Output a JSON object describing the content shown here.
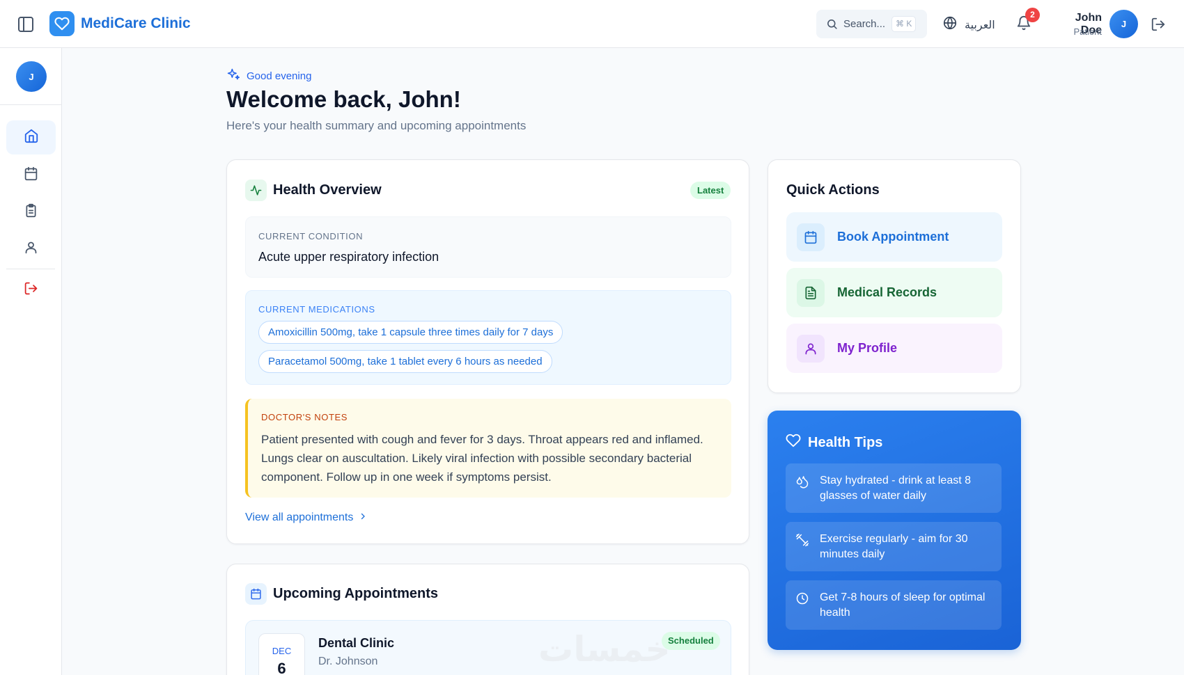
{
  "header": {
    "brand": "MediCare Clinic",
    "search_placeholder": "Search...",
    "search_shortcut": "⌘ K",
    "language": "العربية",
    "notifications_count": "2",
    "user_name": "John Doe",
    "user_role": "Patient",
    "avatar_initial": "J"
  },
  "sidebar": {
    "avatar_initial": "J",
    "items": [
      {
        "name": "home",
        "active": true
      },
      {
        "name": "appointments",
        "active": false
      },
      {
        "name": "records",
        "active": false
      },
      {
        "name": "profile",
        "active": false
      },
      {
        "name": "logout",
        "active": false
      }
    ]
  },
  "hero": {
    "greeting": "Good evening",
    "title": "Welcome back, John!",
    "subtitle": "Here's your health summary and upcoming appointments"
  },
  "overview": {
    "title": "Health Overview",
    "badge": "Latest",
    "condition_label": "CURRENT CONDITION",
    "condition": "Acute upper respiratory infection",
    "medications_label": "CURRENT MEDICATIONS",
    "medications": [
      "Amoxicillin 500mg, take 1 capsule three times daily for 7 days",
      "Paracetamol 500mg, take 1 tablet every 6 hours as needed"
    ],
    "notes_label": "DOCTOR'S NOTES",
    "notes": "Patient presented with cough and fever for 3 days. Throat appears red and inflamed. Lungs clear on auscultation. Likely viral infection with possible secondary bacterial component. Follow up in one week if symptoms persist.",
    "view_all": "View all appointments"
  },
  "upcoming": {
    "title": "Upcoming Appointments",
    "appointments": [
      {
        "month": "DEC",
        "day": "6",
        "clinic": "Dental Clinic",
        "doctor": "Dr. Johnson",
        "status": "Scheduled"
      }
    ],
    "watermark": "خمسات"
  },
  "quick_actions": {
    "title": "Quick Actions",
    "items": [
      {
        "label": "Book Appointment",
        "color": "#1d6fd8",
        "bg": "#eef7fe",
        "icon": "calendar-icon"
      },
      {
        "label": "Medical Records",
        "color": "#166534",
        "bg": "#eefcf3",
        "icon": "document-icon"
      },
      {
        "label": "My Profile",
        "color": "#7e22ce",
        "bg": "#faf3fe",
        "icon": "user-icon"
      }
    ]
  },
  "health_tips": {
    "title": "Health Tips",
    "tips": [
      {
        "text": "Stay hydrated - drink at least 8 glasses of water daily",
        "icon": "droplets-icon"
      },
      {
        "text": "Exercise regularly - aim for 30 minutes daily",
        "icon": "dumbbell-icon"
      },
      {
        "text": "Get 7-8 hours of sleep for optimal health",
        "icon": "clock-icon"
      }
    ]
  },
  "colors": {
    "primary": "#1d6fd8",
    "accent": "#2f8ff0",
    "success": "#15803d",
    "warning": "#f5c220",
    "danger": "#ef4444"
  }
}
